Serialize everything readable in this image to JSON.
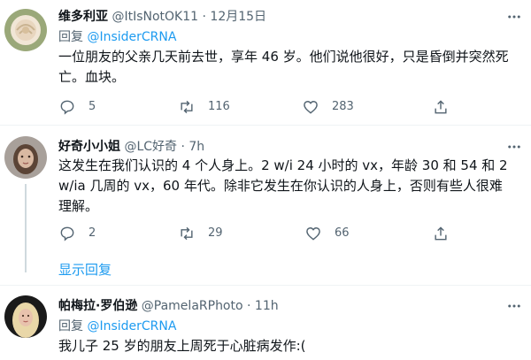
{
  "tweets": [
    {
      "name": "维多利亚",
      "handle": "@ItIsNotOK11",
      "sep": "·",
      "time": "12月15日",
      "reply_prefix": "回复",
      "reply_to": "@InsiderCRNA",
      "text": "一位朋友的父亲几天前去世，享年 46 岁。他们说他很好，只是昏倒并突然死亡。血块。",
      "replies": "5",
      "retweets": "116",
      "likes": "283"
    },
    {
      "name": "好奇小小姐",
      "handle": "@LC好奇",
      "sep": "·",
      "time": "7h",
      "text": "这发生在我们认识的 4 个人身上。2 w/i 24 小时的 vx，年龄 30 和 54 和 2 w/ia 几周的 vx，60 年代。除非它发生在你认识的人身上，否则有些人很难理解。",
      "replies": "2",
      "retweets": "29",
      "likes": "66"
    },
    {
      "name": "帕梅拉·罗伯逊",
      "handle": "@PamelaRPhoto",
      "sep": "·",
      "time": "11h",
      "reply_prefix": "回复",
      "reply_to": "@InsiderCRNA",
      "text": "我儿子 25 岁的朋友上周死于心脏病发作:("
    }
  ],
  "show_replies_label": "显示回复",
  "icons": [
    "more-icon",
    "reply-icon",
    "retweet-icon",
    "like-icon",
    "share-icon"
  ],
  "colors": {
    "link": "#1d9bf0",
    "muted": "#536471",
    "text": "#0f1419",
    "divider": "#eff3f4"
  }
}
